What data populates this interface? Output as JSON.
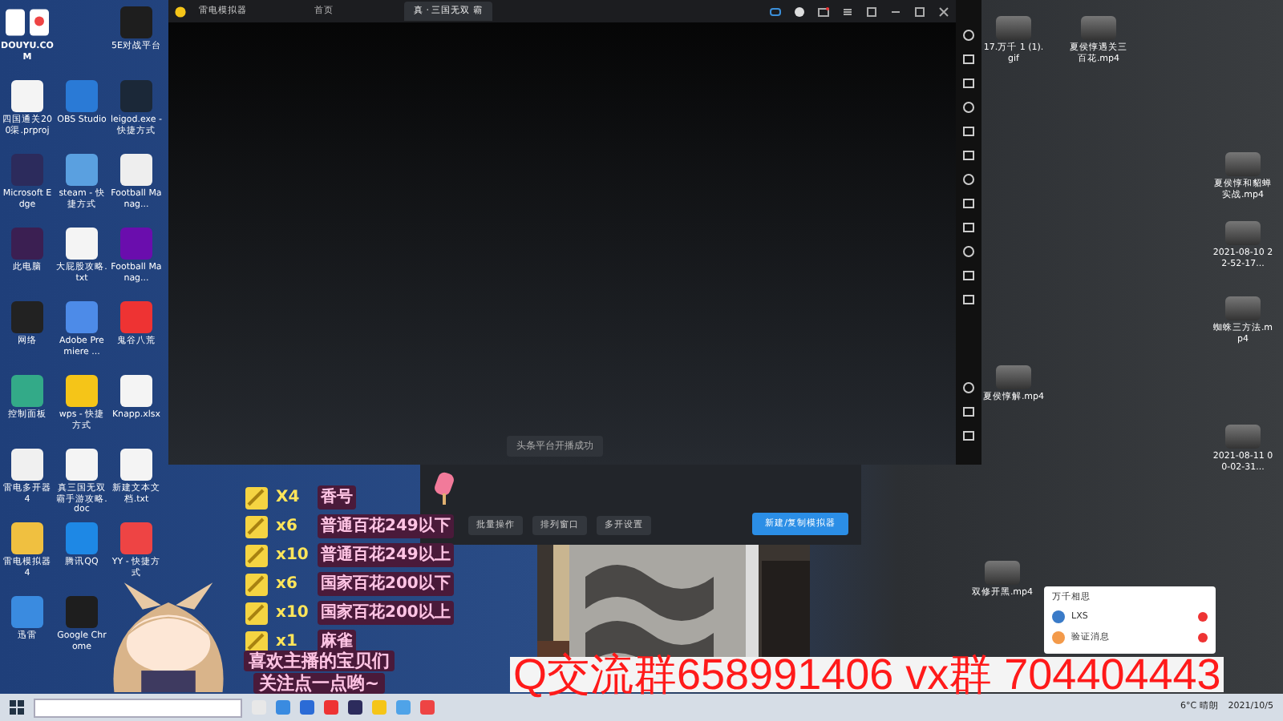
{
  "desktop_left": [
    {
      "label": "DOUYU.COM",
      "kind": "logo"
    },
    {
      "label": "5E对战平台",
      "kind": "app"
    },
    {
      "label": "四国通关200渠.prproj",
      "kind": "file"
    },
    {
      "label": "OBS Studio",
      "kind": "app"
    },
    {
      "label": "leigod.exe - 快捷方式",
      "kind": "app"
    },
    {
      "label": "Microsoft Edge",
      "kind": "app"
    },
    {
      "label": "steam - 快捷方式",
      "kind": "app"
    },
    {
      "label": "Football Manag...",
      "kind": "app"
    },
    {
      "label": "此电脑",
      "kind": "app"
    },
    {
      "label": "大屁股攻略.txt",
      "kind": "file"
    },
    {
      "label": "Football Manag...",
      "kind": "app"
    },
    {
      "label": "网络",
      "kind": "app"
    },
    {
      "label": "Adobe Premiere ...",
      "kind": "app"
    },
    {
      "label": "鬼谷八荒",
      "kind": "app"
    },
    {
      "label": "控制面板",
      "kind": "app"
    },
    {
      "label": "wps - 快捷方式",
      "kind": "app"
    },
    {
      "label": "Knapp.xlsx",
      "kind": "file"
    },
    {
      "label": "雷电多开器4",
      "kind": "app"
    },
    {
      "label": "真三国无双霸手游攻略.doc",
      "kind": "file"
    },
    {
      "label": "新建文本文档.txt",
      "kind": "file"
    },
    {
      "label": "雷电模拟器4",
      "kind": "app"
    },
    {
      "label": "腾讯QQ",
      "kind": "app"
    },
    {
      "label": "YY - 快捷方式",
      "kind": "app"
    },
    {
      "label": "迅雷",
      "kind": "app"
    },
    {
      "label": "Google Chrome",
      "kind": "app"
    }
  ],
  "desktop_right": [
    {
      "label": "17.万千 1 (1).gif"
    },
    {
      "label": "夏侯惇遇关三百花.mp4"
    },
    {
      "label": "夏侯惇和貂蝉实战.mp4"
    },
    {
      "label": "2021-08-10 22-52-17..."
    },
    {
      "label": "蜘蛛三方法.mp4"
    },
    {
      "label": "夏侯惇解.mp4"
    },
    {
      "label": "2021-08-11 00-02-31..."
    },
    {
      "label": "双修开黑.mp4"
    }
  ],
  "emulator": {
    "title": "雷电模拟器",
    "tabs": [
      {
        "label": "首页",
        "selected": false
      },
      {
        "label": "真 · 三国无双 霸",
        "selected": true
      }
    ],
    "toast": "头条平台开播成功"
  },
  "multi_panel": {
    "buttons": [
      {
        "label": "批量操作",
        "primary": false
      },
      {
        "label": "排列窗口",
        "primary": false
      },
      {
        "label": "多开设置",
        "primary": false
      },
      {
        "label": "新建/复制模拟器",
        "primary": true
      }
    ]
  },
  "gift_list": [
    {
      "count": "X4",
      "text": "香号"
    },
    {
      "count": "x6",
      "text": "普通百花249以下"
    },
    {
      "count": "x10",
      "text": "普通百花249以上"
    },
    {
      "count": "x6",
      "text": "国家百花200以下"
    },
    {
      "count": "x10",
      "text": "国家百花200以上"
    },
    {
      "count": "x1",
      "text": "麻雀"
    }
  ],
  "follow_text": [
    "喜欢主播的宝贝们",
    "关注点一点哟~"
  ],
  "group_banner": "Q交流群658991406  vx群 704404443",
  "qq_popup": {
    "title": "万千相思",
    "items": [
      {
        "name": "LXS"
      },
      {
        "name": "验证消息"
      }
    ]
  },
  "taskbar": {
    "weather": "6°C 晴朗",
    "date": "2021/10/5"
  }
}
